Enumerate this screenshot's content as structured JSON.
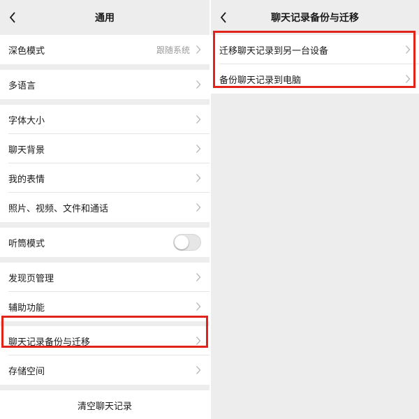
{
  "left": {
    "title": "通用",
    "groups": [
      [
        {
          "label": "深色模式",
          "value": "跟随系统"
        }
      ],
      [
        {
          "label": "多语言"
        }
      ],
      [
        {
          "label": "字体大小"
        },
        {
          "label": "聊天背景"
        },
        {
          "label": "我的表情"
        },
        {
          "label": "照片、视频、文件和通话"
        }
      ],
      [
        {
          "label": "听筒模式",
          "toggle": false
        }
      ],
      [
        {
          "label": "发现页管理"
        },
        {
          "label": "辅助功能"
        },
        {
          "label": "聊天记录备份与迁移"
        },
        {
          "label": "存储空间"
        }
      ]
    ],
    "clear_label": "清空聊天记录"
  },
  "right": {
    "title": "聊天记录备份与迁移",
    "items": [
      {
        "label": "迁移聊天记录到另一台设备"
      },
      {
        "label": "备份聊天记录到电脑"
      }
    ]
  },
  "colors": {
    "highlight": "#e2231a",
    "background": "#ededed",
    "row": "#ffffff"
  },
  "icons": {
    "back": "chevron-left-icon",
    "row_arrow": "chevron-right-icon"
  }
}
